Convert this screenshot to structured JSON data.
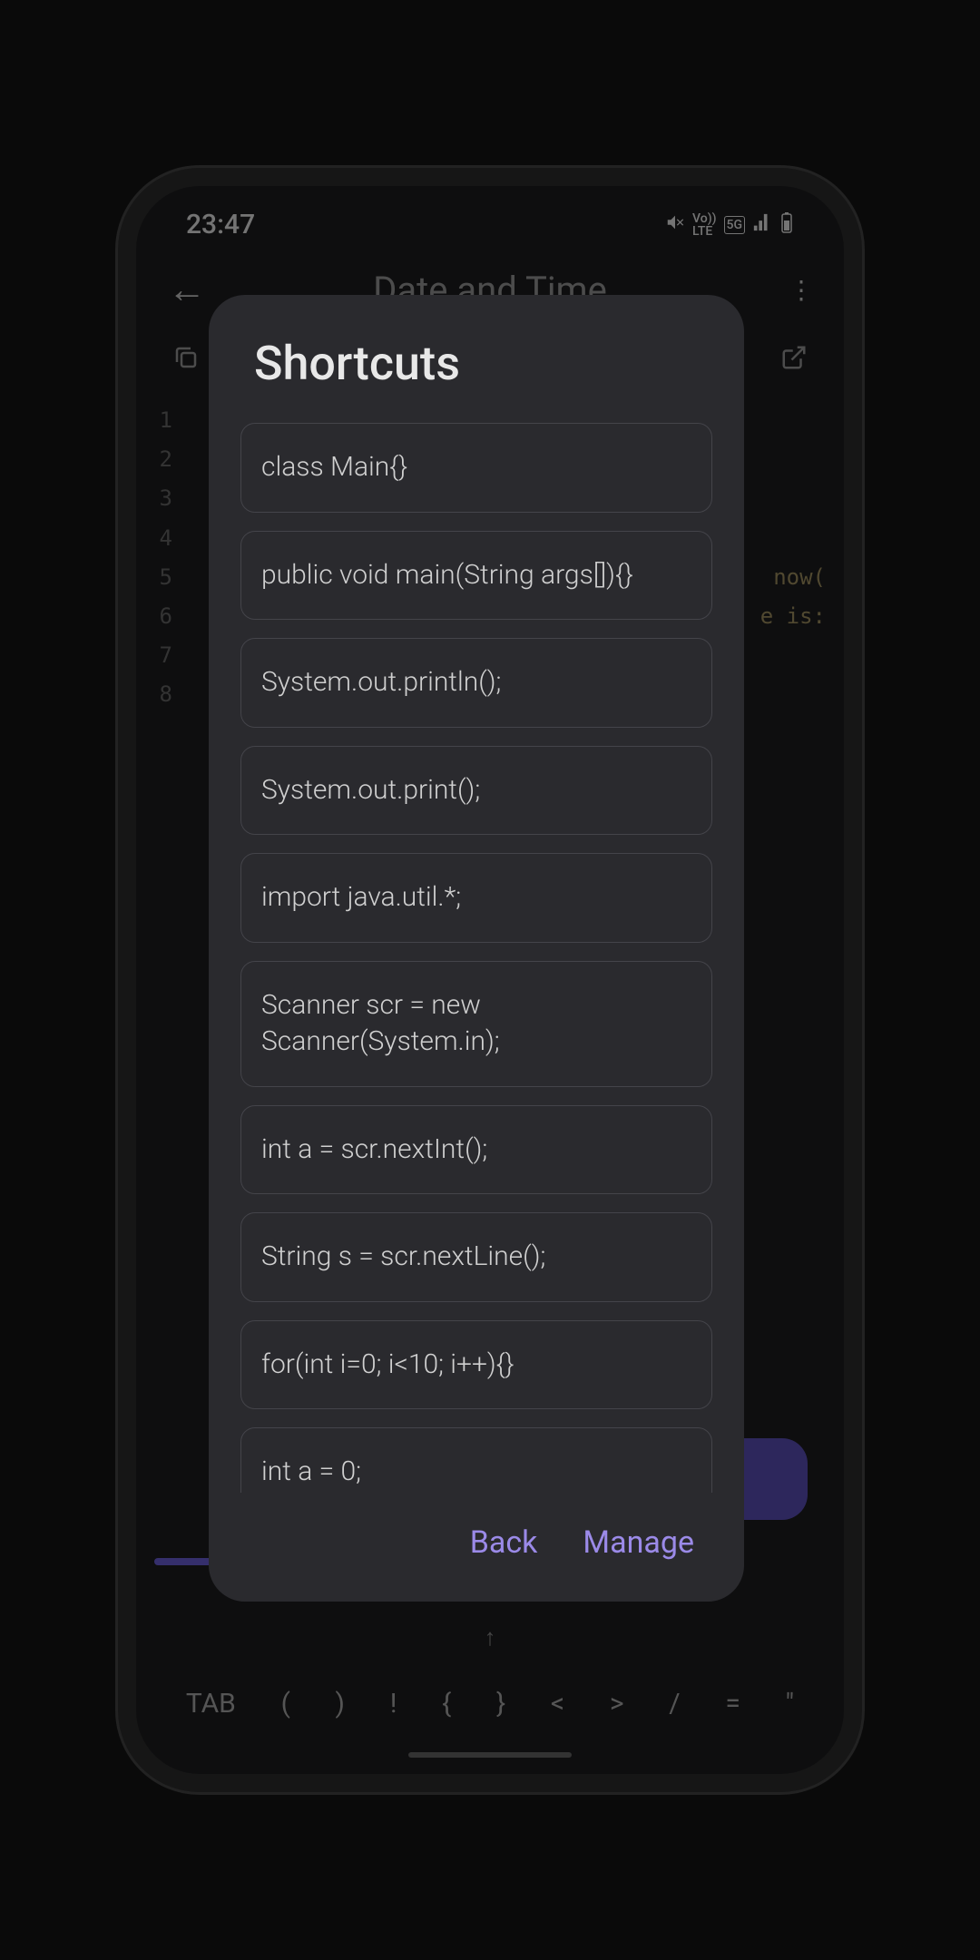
{
  "status_bar": {
    "time": "23:47",
    "lte": "LTE",
    "vo": "Vo))",
    "network": "5G"
  },
  "header": {
    "title": "Date and Time"
  },
  "editor": {
    "lines": [
      {
        "num": "1",
        "content": ""
      },
      {
        "num": "2",
        "content": ""
      },
      {
        "num": "3",
        "content": ""
      },
      {
        "num": "4",
        "content": ""
      },
      {
        "num": "5",
        "content": "now("
      },
      {
        "num": "6",
        "content": "e is:"
      },
      {
        "num": "7",
        "content": ""
      },
      {
        "num": "8",
        "content": ""
      }
    ]
  },
  "dialog": {
    "title": "Shortcuts",
    "shortcuts": [
      "class Main{}",
      "public void main(String args[]){}",
      "System.out.println();",
      "System.out.print();",
      "import java.util.*;",
      "Scanner scr = new Scanner(System.in);",
      "int a = scr.nextInt();",
      "String s = scr.nextLine();",
      "for(int i=0; i<10; i++){}",
      "int a = 0;"
    ],
    "back_label": "Back",
    "manage_label": "Manage"
  },
  "keyboard": {
    "row1": [
      "↑",
      "",
      "",
      "",
      "",
      "",
      "",
      ""
    ],
    "row2": [
      "TAB",
      "(",
      ")",
      "!",
      "{",
      "}",
      "<",
      ">",
      "/",
      "=",
      "\""
    ]
  }
}
